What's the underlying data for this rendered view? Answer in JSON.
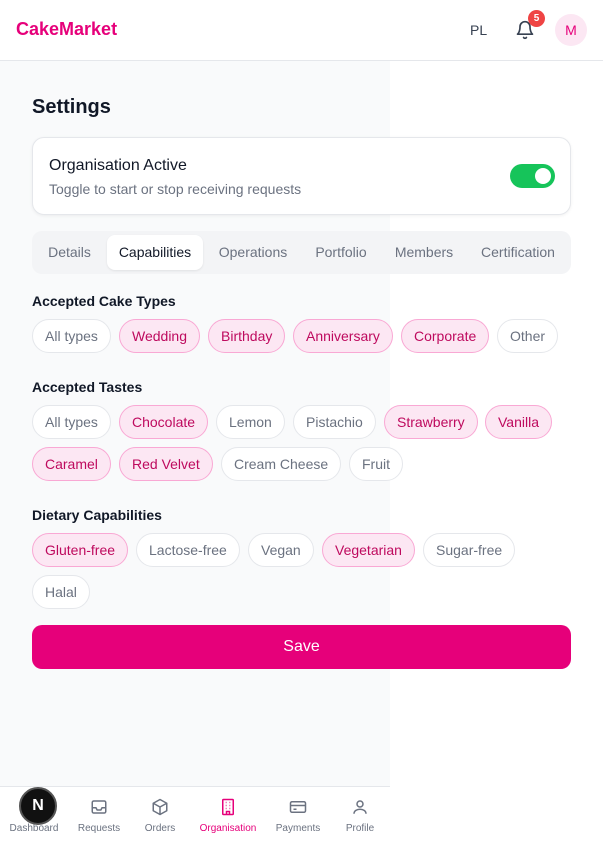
{
  "header": {
    "logo": "CakeMarket",
    "language": "PL",
    "notification_count": "5",
    "avatar_initial": "M"
  },
  "page": {
    "title": "Settings"
  },
  "org_status": {
    "title": "Organisation Active",
    "subtitle": "Toggle to start or stop receiving requests",
    "active": true
  },
  "tabs": [
    {
      "label": "Details",
      "active": false
    },
    {
      "label": "Capabilities",
      "active": true
    },
    {
      "label": "Operations",
      "active": false
    },
    {
      "label": "Portfolio",
      "active": false
    },
    {
      "label": "Members",
      "active": false
    },
    {
      "label": "Certification",
      "active": false
    }
  ],
  "cake_types": {
    "heading": "Accepted Cake Types",
    "options": [
      {
        "label": "All types",
        "selected": false
      },
      {
        "label": "Wedding",
        "selected": true
      },
      {
        "label": "Birthday",
        "selected": true
      },
      {
        "label": "Anniversary",
        "selected": true
      },
      {
        "label": "Corporate",
        "selected": true
      },
      {
        "label": "Other",
        "selected": false
      }
    ]
  },
  "tastes": {
    "heading": "Accepted Tastes",
    "options": [
      {
        "label": "All types",
        "selected": false
      },
      {
        "label": "Chocolate",
        "selected": true
      },
      {
        "label": "Lemon",
        "selected": false
      },
      {
        "label": "Pistachio",
        "selected": false
      },
      {
        "label": "Strawberry",
        "selected": true
      },
      {
        "label": "Vanilla",
        "selected": true
      },
      {
        "label": "Caramel",
        "selected": true
      },
      {
        "label": "Red Velvet",
        "selected": true
      },
      {
        "label": "Cream Cheese",
        "selected": false
      },
      {
        "label": "Fruit",
        "selected": false
      }
    ]
  },
  "dietary": {
    "heading": "Dietary Capabilities",
    "options": [
      {
        "label": "Gluten-free",
        "selected": true
      },
      {
        "label": "Lactose-free",
        "selected": false
      },
      {
        "label": "Vegan",
        "selected": false
      },
      {
        "label": "Vegetarian",
        "selected": true
      },
      {
        "label": "Sugar-free",
        "selected": false
      },
      {
        "label": "Halal",
        "selected": false
      }
    ]
  },
  "save_label": "Save",
  "fab_label": "N",
  "bottom_nav": [
    {
      "label": "Dashboard",
      "icon": "dashboard-icon",
      "active": false
    },
    {
      "label": "Requests",
      "icon": "inbox-icon",
      "active": false
    },
    {
      "label": "Orders",
      "icon": "box-icon",
      "active": false
    },
    {
      "label": "Organisation",
      "icon": "building-icon",
      "active": true
    },
    {
      "label": "Payments",
      "icon": "credit-card-icon",
      "active": false
    },
    {
      "label": "Profile",
      "icon": "user-icon",
      "active": false
    }
  ],
  "colors": {
    "brand": "#e6007a",
    "toggle_on": "#16c45a",
    "chip_selected_bg": "#fce7f3",
    "badge": "#ef4444"
  }
}
